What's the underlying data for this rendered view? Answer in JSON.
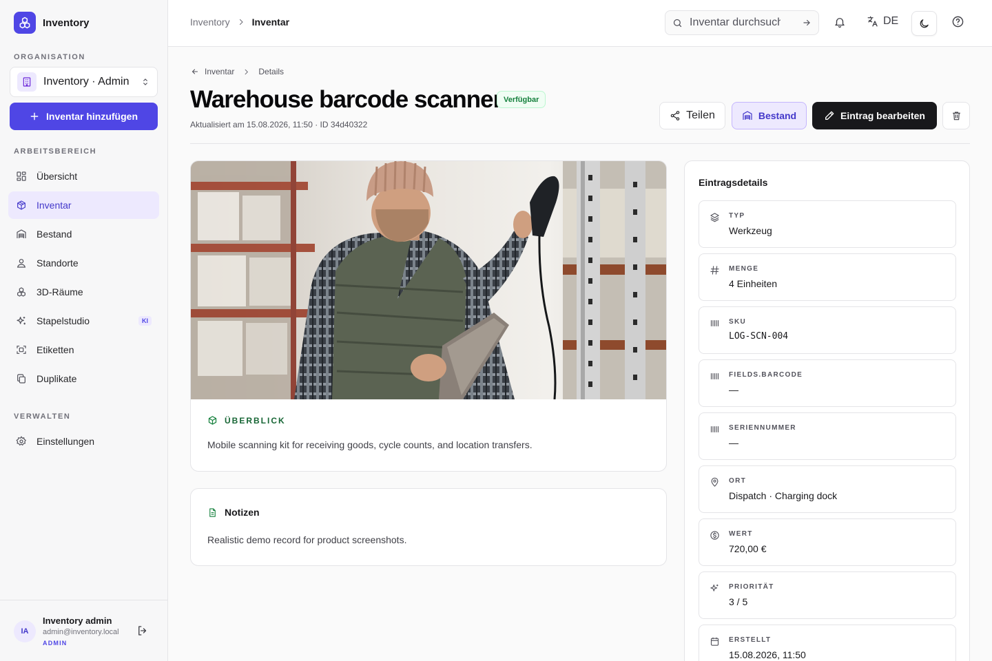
{
  "app": {
    "name": "Inventory"
  },
  "sidebar": {
    "org_label": "ORGANISATION",
    "org_name": "Inventory · Admin",
    "add_button": "Inventar hinzufügen",
    "workspace_label": "ARBEITSBEREICH",
    "manage_label": "VERWALTEN",
    "items": [
      {
        "label": "Übersicht",
        "icon": "grid-icon"
      },
      {
        "label": "Inventar",
        "icon": "package-icon",
        "active": true
      },
      {
        "label": "Bestand",
        "icon": "warehouse-icon"
      },
      {
        "label": "Standorte",
        "icon": "map-pin-icon"
      },
      {
        "label": "3D-Räume",
        "icon": "cubes-icon"
      },
      {
        "label": "Stapelstudio",
        "icon": "sparkles-icon",
        "badge": "KI"
      },
      {
        "label": "Etiketten",
        "icon": "scan-icon"
      },
      {
        "label": "Duplikate",
        "icon": "copy-icon"
      }
    ],
    "settings": {
      "label": "Einstellungen",
      "icon": "gear-icon"
    },
    "user": {
      "initials": "IA",
      "name": "Inventory admin",
      "email": "admin@inventory.local",
      "role": "ADMIN"
    }
  },
  "topbar": {
    "breadcrumb_parent": "Inventory",
    "breadcrumb_current": "Inventar",
    "search_placeholder": "Inventar durchsuchen",
    "language": "DE"
  },
  "page": {
    "crumb_back": "Inventar",
    "crumb_current": "Details",
    "title": "Warehouse barcode scanner",
    "status": "Verfügbar",
    "status_color": "#15803d",
    "meta": "Aktualisiert am 15.08.2026, 11:50 · ID 34d40322",
    "buttons": {
      "share": "Teilen",
      "stock": "Bestand",
      "edit": "Eintrag bearbeiten"
    },
    "accent": "#4f46e5"
  },
  "overview": {
    "title": "ÜBERBLICK",
    "text": "Mobile scanning kit for receiving goods, cycle counts, and location transfers."
  },
  "notes": {
    "title": "Notizen",
    "text": "Realistic demo record for product screenshots."
  },
  "details": {
    "title": "Eintragsdetails",
    "rows": [
      {
        "label": "TYP",
        "value": "Werkzeug",
        "icon": "layers-icon"
      },
      {
        "label": "MENGE",
        "value": "4 Einheiten",
        "icon": "hash-icon"
      },
      {
        "label": "SKU",
        "value": "LOG-SCN-004",
        "icon": "barcode-icon"
      },
      {
        "label": "FIELDS.BARCODE",
        "value": "—",
        "icon": "barcode-icon"
      },
      {
        "label": "SERIENNUMMER",
        "value": "—",
        "icon": "barcode-icon"
      },
      {
        "label": "ORT",
        "value": "Dispatch · Charging dock",
        "icon": "map-pin-icon"
      },
      {
        "label": "WERT",
        "value": "720,00 €",
        "icon": "currency-icon"
      },
      {
        "label": "PRIORITÄT",
        "value": "3 / 5",
        "icon": "sparkles-icon"
      },
      {
        "label": "ERSTELLT",
        "value": "15.08.2026, 11:50",
        "icon": "calendar-icon"
      }
    ]
  }
}
